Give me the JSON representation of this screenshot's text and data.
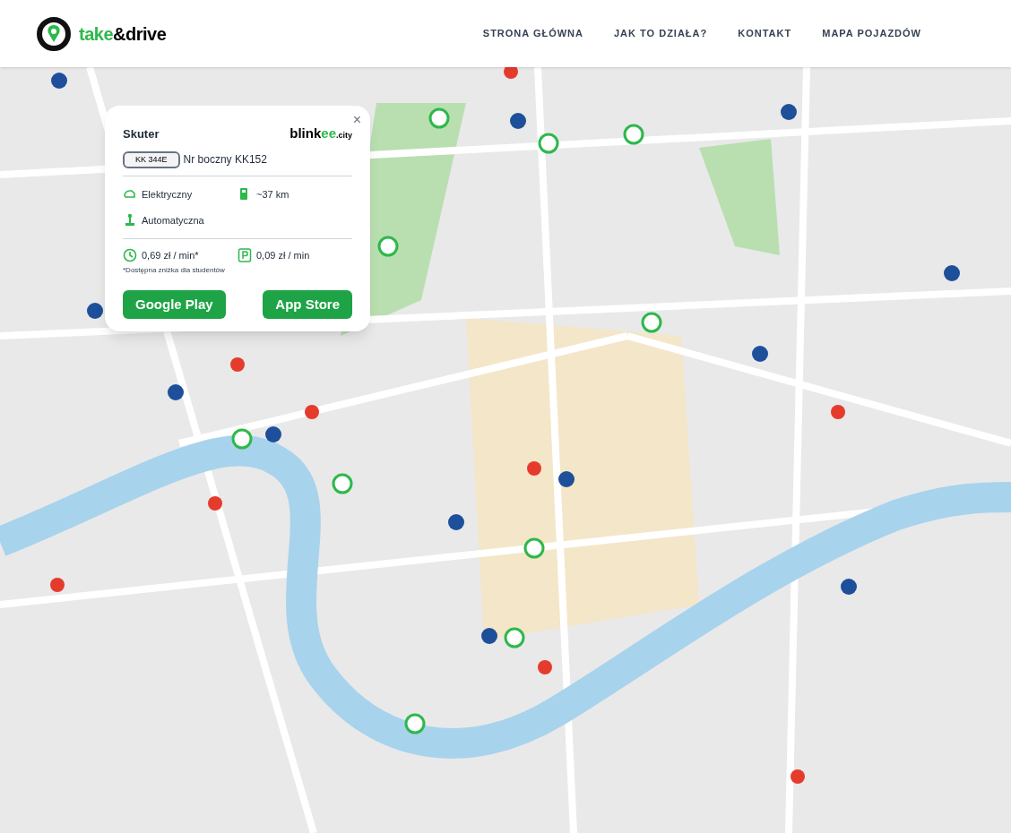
{
  "header": {
    "logo": {
      "accent": "take",
      "rest": "&drive"
    },
    "nav": [
      {
        "label": "STRONA GŁÓWNA",
        "selected": false
      },
      {
        "label": "JAK TO DZIAŁA?",
        "selected": false
      },
      {
        "label": "KONTAKT",
        "selected": false
      },
      {
        "label": "MAPA POJAZDÓW",
        "selected": false
      }
    ]
  },
  "popup": {
    "close": "×",
    "type": "Skuter",
    "brand": [
      {
        "kind": "dark",
        "text": "blink"
      },
      {
        "kind": "accent",
        "text": "ee"
      },
      {
        "kind": "small",
        "text": ".city"
      }
    ],
    "plate": "KK 344E",
    "side_number": "Nr boczny KK152",
    "features": [
      {
        "kind": "engine",
        "text": "Elektryczny"
      },
      {
        "kind": "fuel",
        "text": "~37 km"
      },
      {
        "kind": "gearbox",
        "text": "Automatyczna"
      }
    ],
    "prices": [
      {
        "kind": "drive",
        "text": "0,69 zł / min*"
      },
      {
        "kind": "parking",
        "text": "0,09 zł / min"
      }
    ],
    "footnote": "*Dostępna zniżka dla studentów",
    "buttons": [
      "Google Play",
      "App Store"
    ]
  }
}
